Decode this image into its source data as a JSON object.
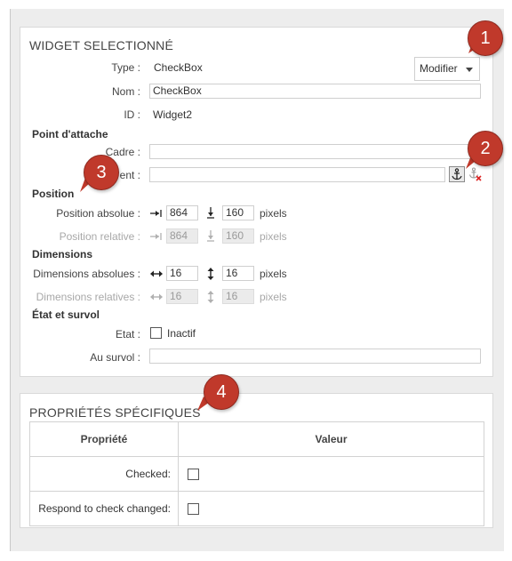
{
  "widget": {
    "title": "WIDGET SELECTIONNÉ",
    "modify_label": "Modifier",
    "type_label": "Type :",
    "type_value": "CheckBox",
    "name_label": "Nom :",
    "name_value": "CheckBox",
    "id_label": "ID :",
    "id_value": "Widget2",
    "attach_section": "Point d'attache",
    "frame_label": "Cadre :",
    "frame_value": "",
    "element_label": "ent :",
    "element_value": "",
    "anchor_icon": "anchor-icon",
    "unanchor_icon": "anchor-remove-icon",
    "position_section": "Position",
    "abs_pos_label": "Position absolue :",
    "abs_pos_x": "864",
    "abs_pos_y": "160",
    "rel_pos_label": "Position relative :",
    "rel_pos_x": "864",
    "rel_pos_y": "160",
    "unit": "pixels",
    "dimensions_section": "Dimensions",
    "abs_dim_label": "Dimensions absolues :",
    "abs_dim_w": "16",
    "abs_dim_h": "16",
    "rel_dim_label": "Dimensions relatives :",
    "rel_dim_w": "16",
    "rel_dim_h": "16",
    "state_section": "État et survol",
    "state_label": "Etat :",
    "state_value": "Inactif",
    "hover_label": "Au survol :",
    "hover_value": ""
  },
  "props": {
    "title": "PROPRIÉTÉS SPÉCIFIQUES",
    "col_property": "Propriété",
    "col_value": "Valeur",
    "rows": [
      {
        "name": "Checked:"
      },
      {
        "name": "Respond to check changed:"
      }
    ]
  },
  "badges": [
    "1",
    "2",
    "3",
    "4"
  ],
  "colors": {
    "badge": "#c0392b",
    "panel_bg": "#ededed"
  }
}
